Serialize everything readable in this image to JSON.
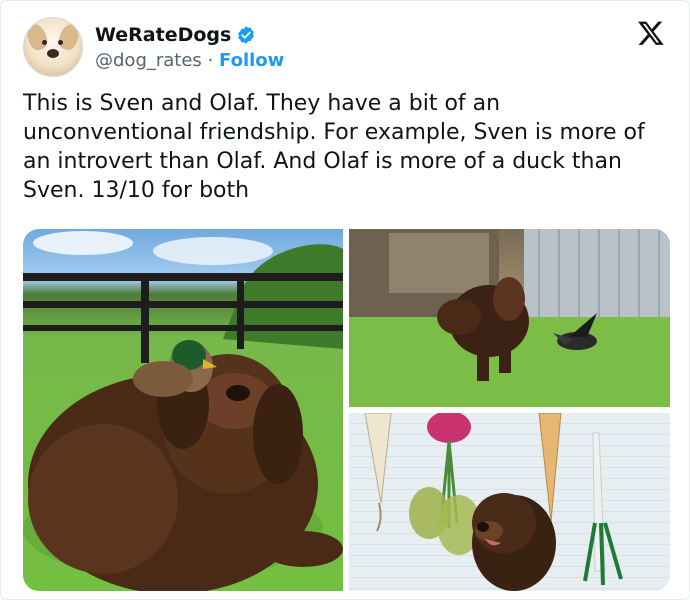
{
  "user": {
    "display_name": "WeRateDogs",
    "handle": "@dog_rates",
    "separator": "·",
    "follow_label": "Follow"
  },
  "tweet": {
    "text": "This is Sven and Olaf. They have a bit of an unconventional friendship. For example, Sven is more of an introvert than Olaf. And Olaf is more of a duck than Sven. 13/10 for both"
  },
  "colors": {
    "accent": "#1d9bf0",
    "text": "#0f1419",
    "secondary_text": "#536471"
  },
  "icons": {
    "verified": "verified-badge-icon",
    "brand": "x-logo-icon"
  }
}
